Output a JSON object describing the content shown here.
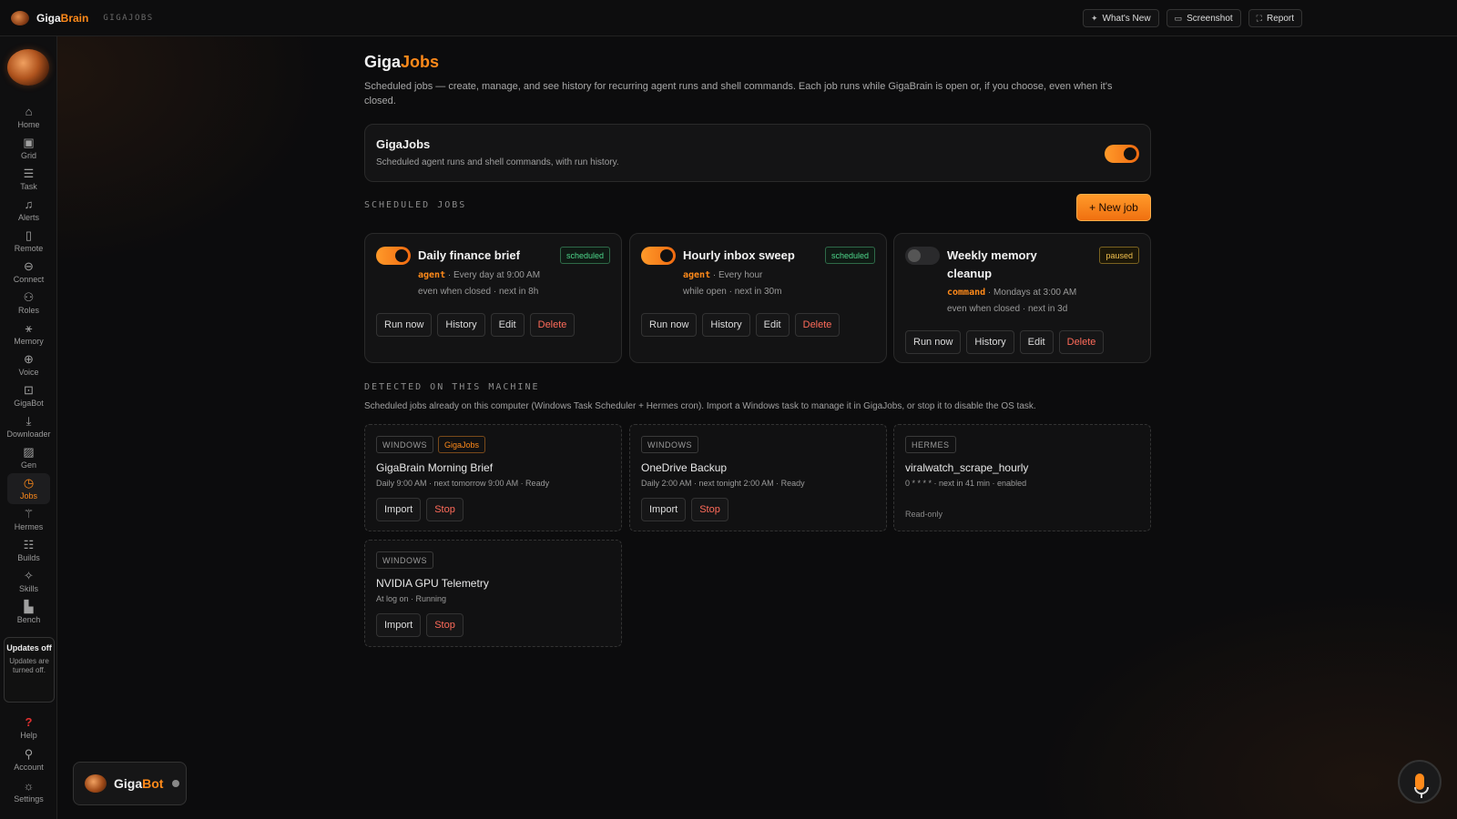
{
  "app": {
    "name_part1": "Giga",
    "name_part2": "Brain",
    "crumb": "GIGAJOBS"
  },
  "topbar": {
    "actions": [
      {
        "icon": "sparkle-icon",
        "glyph": "✦",
        "label": "What's New"
      },
      {
        "icon": "screenshot-icon",
        "glyph": "▭",
        "label": "Screenshot"
      },
      {
        "icon": "report-icon",
        "glyph": "⛶",
        "label": "Report"
      }
    ]
  },
  "sidebar": {
    "items": [
      {
        "icon": "home-icon",
        "glyph": "⌂",
        "label": "Home"
      },
      {
        "icon": "grid-icon",
        "glyph": "▣",
        "label": "Grid"
      },
      {
        "icon": "task-icon",
        "glyph": "☰",
        "label": "Task"
      },
      {
        "icon": "bell-icon",
        "glyph": "♫",
        "label": "Alerts"
      },
      {
        "icon": "phone-icon",
        "glyph": "▯",
        "label": "Remote"
      },
      {
        "icon": "link-icon",
        "glyph": "⊖",
        "label": "Connect"
      },
      {
        "icon": "users-icon",
        "glyph": "⚇",
        "label": "Roles"
      },
      {
        "icon": "memory-icon",
        "glyph": "⚹",
        "label": "Memory"
      },
      {
        "icon": "mic-icon",
        "glyph": "⊕",
        "label": "Voice"
      },
      {
        "icon": "robot-icon",
        "glyph": "⊡",
        "label": "GigaBot"
      },
      {
        "icon": "download-icon",
        "glyph": "⤓",
        "label": "Downloader"
      },
      {
        "icon": "image-icon",
        "glyph": "▨",
        "label": "Gen"
      },
      {
        "icon": "clock-icon",
        "glyph": "◷",
        "label": "Jobs"
      },
      {
        "icon": "hermes-icon",
        "glyph": "⚚",
        "label": "Hermes"
      },
      {
        "icon": "server-icon",
        "glyph": "☷",
        "label": "Builds"
      },
      {
        "icon": "sparkles-icon",
        "glyph": "✧",
        "label": "Skills"
      },
      {
        "icon": "bench-icon",
        "glyph": "▙",
        "label": "Bench"
      }
    ],
    "active": "Jobs",
    "updates": {
      "title": "Updates off",
      "body": "Updates are turned off."
    },
    "bottom": [
      {
        "icon": "help-icon",
        "glyph": "?",
        "label": "Help"
      },
      {
        "icon": "account-icon",
        "glyph": "⚲",
        "label": "Account"
      },
      {
        "icon": "settings-icon",
        "glyph": "☼",
        "label": "Settings"
      }
    ]
  },
  "page": {
    "title_part1": "Giga",
    "title_part2": "Jobs",
    "description": "Scheduled jobs — create, manage, and see history for recurring agent runs and shell commands. Each job runs while GigaBrain is open or, if you choose, even when it's closed."
  },
  "master": {
    "title": "GigaJobs",
    "subtitle": "Scheduled agent runs and shell commands, with run history.",
    "enabled": true
  },
  "scheduled": {
    "label": "SCHEDULED JOBS",
    "new_job_label": "+ New job",
    "jobs": [
      {
        "name": "Daily finance brief",
        "enabled": true,
        "status": "scheduled",
        "kind": "agent",
        "schedule": "Every day at 9:00 AM",
        "detail": "even when closed · next in 8h"
      },
      {
        "name": "Hourly inbox sweep",
        "enabled": true,
        "status": "scheduled",
        "kind": "agent",
        "schedule": "Every hour",
        "detail": "while open · next in 30m"
      },
      {
        "name": "Weekly memory cleanup",
        "enabled": false,
        "status": "paused",
        "kind": "command",
        "schedule": "Mondays at 3:00 AM",
        "detail": "even when closed · next in 3d"
      }
    ],
    "actions": {
      "run": "Run now",
      "history": "History",
      "edit": "Edit",
      "delete": "Delete"
    }
  },
  "detected": {
    "label": "DETECTED ON THIS MACHINE",
    "description": "Scheduled jobs already on this computer (Windows Task Scheduler + Hermes cron). Import a Windows task to manage it in GigaJobs, or stop it to disable the OS task.",
    "items": [
      {
        "tags": [
          "WINDOWS",
          "GigaJobs"
        ],
        "name": "GigaBrain Morning Brief",
        "meta": "Daily 9:00 AM · next tomorrow 9:00 AM · Ready"
      },
      {
        "tags": [
          "WINDOWS"
        ],
        "name": "OneDrive Backup",
        "meta": "Daily 2:00 AM · next tonight 2:00 AM · Ready"
      },
      {
        "tags": [
          "HERMES"
        ],
        "name": "viralwatch_scrape_hourly",
        "meta": "0 * * * * · next in 41 min · enabled",
        "readonly": "Read-only"
      },
      {
        "tags": [
          "WINDOWS"
        ],
        "name": "NVIDIA GPU Telemetry",
        "meta": "At log on · Running"
      }
    ],
    "actions": {
      "import": "Import",
      "stop": "Stop"
    }
  },
  "gigabot": {
    "name_part1": "Giga",
    "name_part2": "Bot"
  },
  "colors": {
    "accent": "#ff8a1a",
    "scheduled": "#4ed68a",
    "paused": "#f2c14e",
    "danger": "#ff6b5a"
  }
}
